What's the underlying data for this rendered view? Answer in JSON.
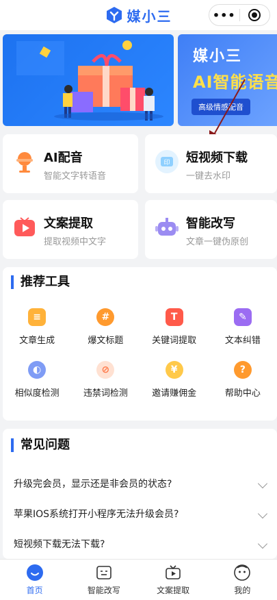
{
  "header": {
    "app_name": "媒小三"
  },
  "banner": {
    "slide2_title": "媒小三",
    "slide2_headline": "AI智能语音",
    "slide2_pill": "高级情感配音"
  },
  "features": [
    {
      "title": "AI配音",
      "subtitle": "智能文字转语音"
    },
    {
      "title": "短视频下载",
      "subtitle": "一键去水印"
    },
    {
      "title": "文案提取",
      "subtitle": "提取视频中文字"
    },
    {
      "title": "智能改写",
      "subtitle": "文章一键伪原创"
    }
  ],
  "tools_section": {
    "title": "推荐工具",
    "items": [
      {
        "label": "文章生成",
        "icon": "document-icon"
      },
      {
        "label": "爆文标题",
        "icon": "hash-icon"
      },
      {
        "label": "关键词提取",
        "icon": "keyword-icon"
      },
      {
        "label": "文本纠错",
        "icon": "edit-icon"
      },
      {
        "label": "相似度检测",
        "icon": "similarity-icon"
      },
      {
        "label": "违禁词检测",
        "icon": "ban-icon"
      },
      {
        "label": "邀请赚佣金",
        "icon": "coin-icon"
      },
      {
        "label": "帮助中心",
        "icon": "help-icon"
      }
    ]
  },
  "faq_section": {
    "title": "常见问题",
    "items": [
      "升级完会员，显示还是非会员的状态?",
      "苹果IOS系统打开小程序无法升级会员?",
      "短视频下载无法下载?"
    ]
  },
  "tabbar": [
    {
      "label": "首页",
      "active": true
    },
    {
      "label": "智能改写"
    },
    {
      "label": "文案提取"
    },
    {
      "label": "我的"
    }
  ],
  "colors": {
    "accent": "#2d6bf0",
    "background": "#f2f3f5"
  }
}
